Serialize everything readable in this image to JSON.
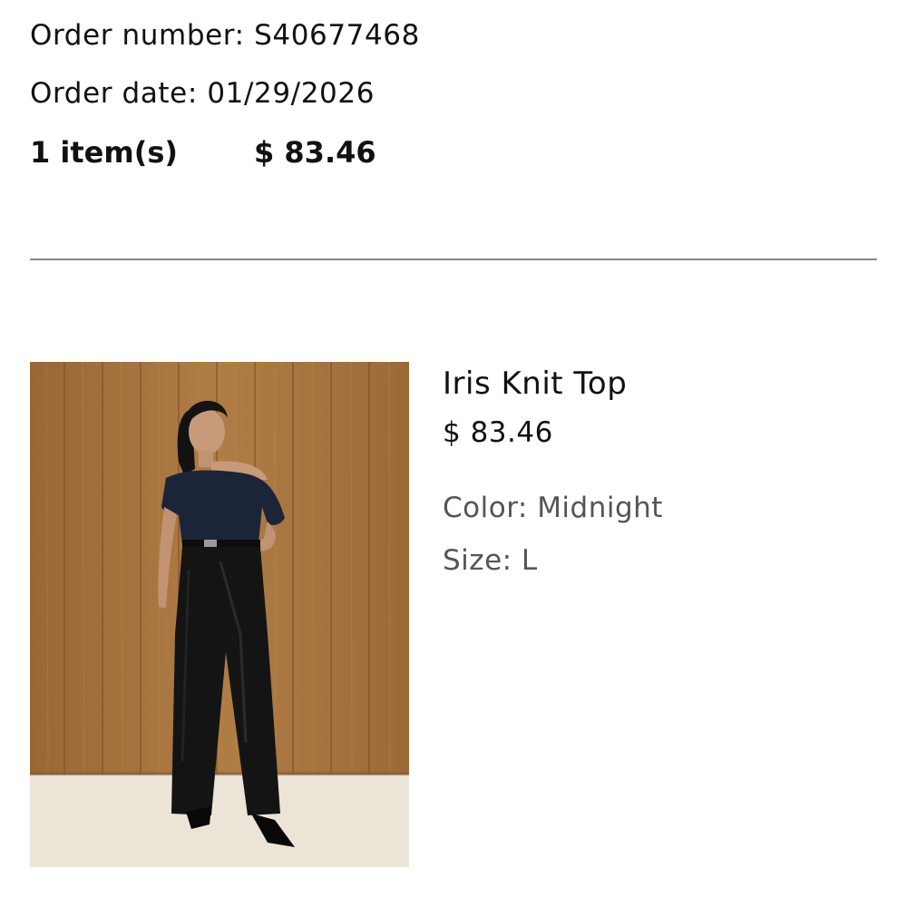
{
  "order": {
    "number_label": "Order number: S40677468",
    "date_label": "Order date: 01/29/2026",
    "items_count": "1 item(s)",
    "total": "$ 83.46"
  },
  "product": {
    "name": "Iris Knit Top",
    "price": "$ 83.46",
    "color": "Color: Midnight",
    "size": "Size: L",
    "image_icon": "product-photo"
  },
  "colors": {
    "text": "#111111",
    "muted": "#555555",
    "divider": "#8a8a8a",
    "wood": "#a8763f",
    "floor": "#ece4d6",
    "top": "#1c2438",
    "pants": "#141414"
  }
}
